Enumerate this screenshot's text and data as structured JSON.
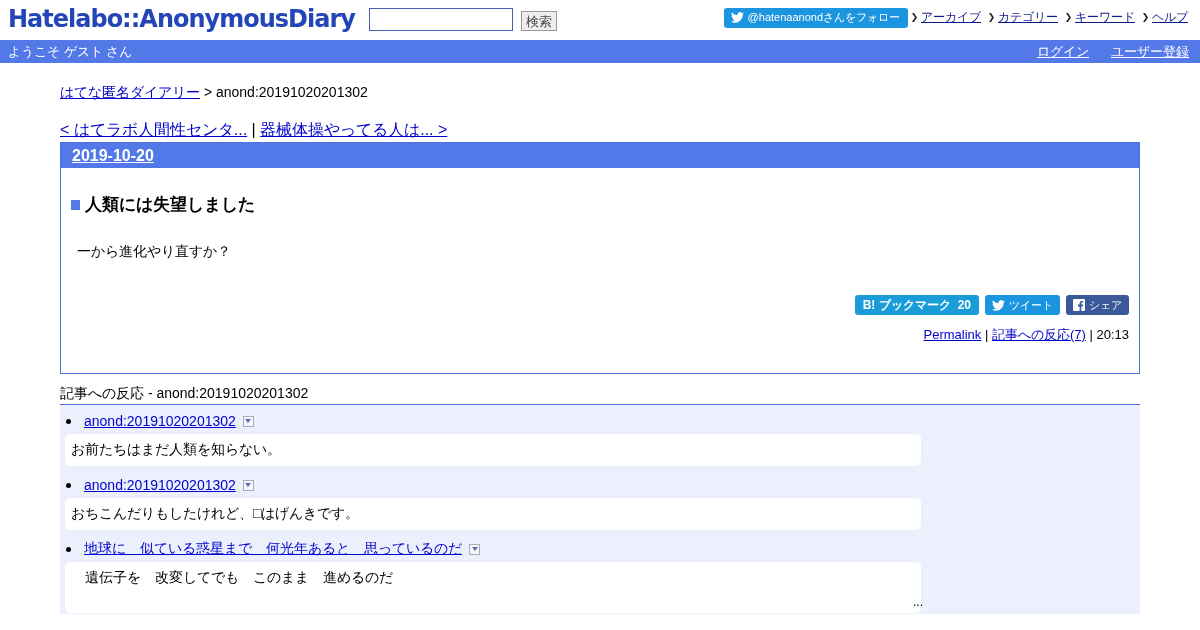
{
  "header": {
    "logo": "Hatelabo::AnonymousDiary",
    "search": {
      "button": "検索"
    },
    "follow_button": "@hatenaanondさんをフォロー",
    "nav_links": [
      "アーカイブ",
      "カテゴリー",
      "キーワード",
      "ヘルプ"
    ]
  },
  "user_bar": {
    "welcome": "ようこそ ゲスト さん",
    "links": [
      "ログイン",
      "ユーザー登録"
    ]
  },
  "breadcrumb": {
    "link": "はてな匿名ダイアリー",
    "separator": ">",
    "current": "anond:20191020201302"
  },
  "pager": {
    "prev": "< はてラボ人間性センタ...",
    "separator": "|",
    "next": "器械体操やってる人は... >"
  },
  "entry": {
    "date": "2019-10-20",
    "title": "人類には失望しました",
    "body": "一から進化やり直すか？",
    "share": [
      {
        "kind": "bookmark",
        "label": "B! ブックマーク",
        "count": "20"
      },
      {
        "kind": "tweet",
        "label": "ツイート"
      },
      {
        "kind": "facebook",
        "label": "シェア"
      }
    ],
    "footer": {
      "permalink": "Permalink",
      "separator_1": "|",
      "reactions_link": "記事への反応(7)",
      "separator_2": "|",
      "time": "20:13"
    }
  },
  "reactions": {
    "heading": "記事への反応 - anond:20191020201302",
    "items": [
      {
        "link": "anond:20191020201302",
        "text": "お前たちはまだ人類を知らない。"
      },
      {
        "link": "anond:20191020201302",
        "text": "おちこんだりもしたけれど、□はげんきです。"
      },
      {
        "link": "地球に　似ている惑星まで　何光年あると　思っているのだ",
        "text": "　遺伝子を　改変してでも　このまま　進めるのだ",
        "more": "..."
      }
    ]
  }
}
